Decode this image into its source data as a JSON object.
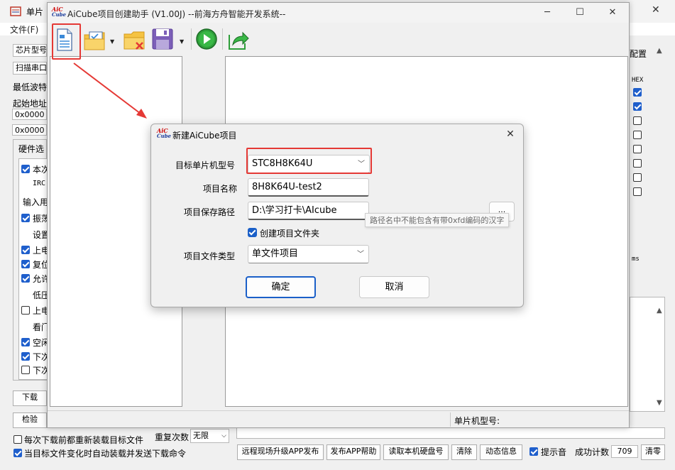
{
  "background_app": {
    "title": "单片",
    "menu_file": "文件(F)",
    "chip_type_label": "芯片型号",
    "scan_port_label": "扫描串口",
    "min_baud_label": "最低波特",
    "start_addr_label": "起始地址",
    "addr1": "0x0000",
    "addr2": "0x0000",
    "hw_options_tab": "硬件选",
    "opt_ben": "本次",
    "opt_irc": "IRC",
    "opt_input": "输入用",
    "opt_zhen": "振荡",
    "opt_she": "设置",
    "opt_shang": "上电",
    "opt_fu": "复位",
    "opt_yun": "允许",
    "opt_di": "低压",
    "opt_shang2": "上电",
    "opt_kan": "看门",
    "opt_kong": "空闲",
    "opt_xia1": "下次",
    "opt_xia2": "下次",
    "left_dl_btn": "下载",
    "left_check_btn": "检验",
    "right_config_label": "配置",
    "hex_label": "HEX",
    "ms_label": "ms",
    "reload_each_label": "每次下载前都重新装载目标文件",
    "repeat_label": "重复次数",
    "repeat_value": "无限",
    "auto_reload_label": "当目标文件变化时自动装载并发送下载命令",
    "btn_remote_upgrade": "远程现场升级APP发布",
    "btn_publish_help": "发布APP帮助",
    "btn_read_disk": "读取本机硬盘号",
    "btn_clear": "清除",
    "btn_dynamic": "动态信息",
    "sound_label": "提示音",
    "success_count_label": "成功计数",
    "success_count_value": "709",
    "btn_clear_count": "清零"
  },
  "main_window": {
    "title": "AiCube项目创建助手 (V1.00J) --前海方舟智能开发系统--",
    "logo_top": "AiC",
    "logo_bottom": "Cube",
    "status_label": "单片机型号:",
    "toolbar_icons": [
      "new-project-icon",
      "open-checklist-icon",
      "close-folder-icon",
      "save-icon",
      "run-icon",
      "export-icon"
    ]
  },
  "dialog": {
    "title": "新建AiCube项目",
    "logo_top": "AiC",
    "logo_bottom": "Cube",
    "mcu_label": "目标单片机型号",
    "mcu_value": "STC8H8K64U",
    "name_label": "项目名称",
    "name_value": "8H8K64U-test2",
    "path_label": "项目保存路径",
    "path_value": "D:\\学习打卡\\AIcube",
    "browse_label": "...",
    "path_tooltip": "路径名中不能包含有带0xfd编码的汉字",
    "create_folder_label": "创建项目文件夹",
    "file_type_label": "项目文件类型",
    "file_type_value": "单文件项目",
    "ok_label": "确定",
    "cancel_label": "取消"
  },
  "colors": {
    "highlight": "#e53935",
    "accent": "#1a5fc8"
  }
}
